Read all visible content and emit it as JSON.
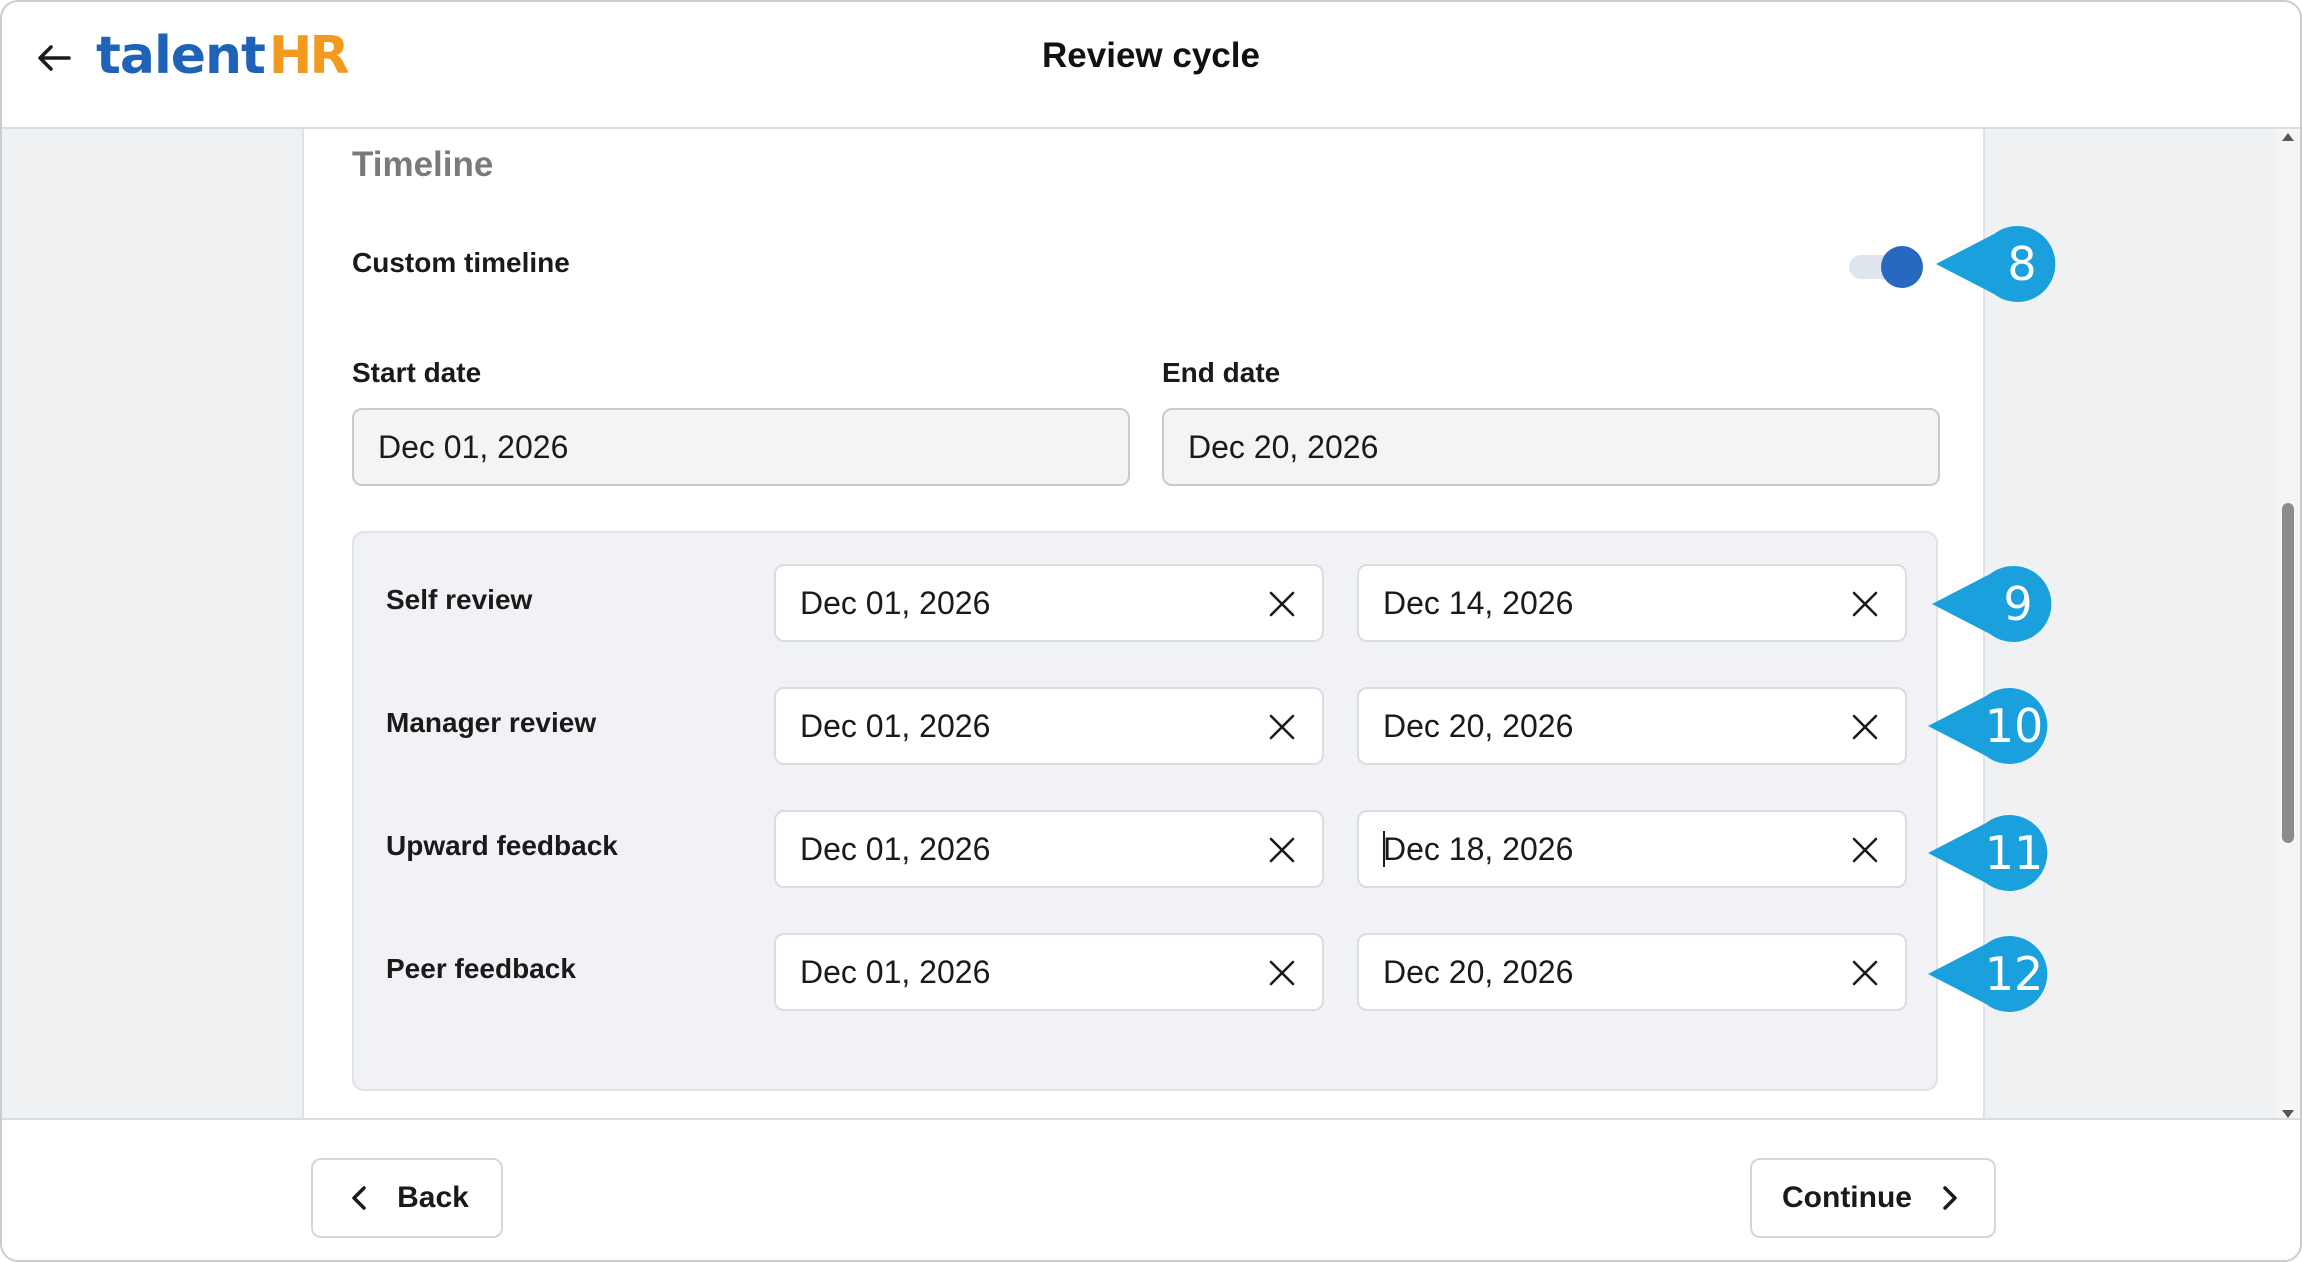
{
  "header": {
    "logo_part1": "talent",
    "logo_part2": "HR",
    "title": "Review cycle",
    "back_icon": "arrow-left-icon"
  },
  "timeline": {
    "section_title": "Timeline",
    "custom_timeline_label": "Custom timeline",
    "custom_timeline_enabled": true,
    "start_date_label": "Start date",
    "start_date_value": "Dec 01, 2026",
    "end_date_label": "End date",
    "end_date_value": "Dec 20, 2026",
    "stages": [
      {
        "label": "Self review",
        "start": "Dec 01, 2026",
        "end": "Dec 14, 2026",
        "callout": "9"
      },
      {
        "label": "Manager review",
        "start": "Dec 01, 2026",
        "end": "Dec 20, 2026",
        "callout": "10"
      },
      {
        "label": "Upward feedback",
        "start": "Dec 01, 2026",
        "end": "Dec 18, 2026",
        "callout": "11"
      },
      {
        "label": "Peer feedback",
        "start": "Dec 01, 2026",
        "end": "Dec 20, 2026",
        "callout": "12"
      }
    ],
    "toggle_callout": "8"
  },
  "footer": {
    "back_label": "Back",
    "continue_label": "Continue"
  },
  "colors": {
    "brand_blue": "#1f63b8",
    "brand_orange": "#f29a1f",
    "toggle_on": "#2768c0",
    "callout": "#1aa0dd"
  }
}
